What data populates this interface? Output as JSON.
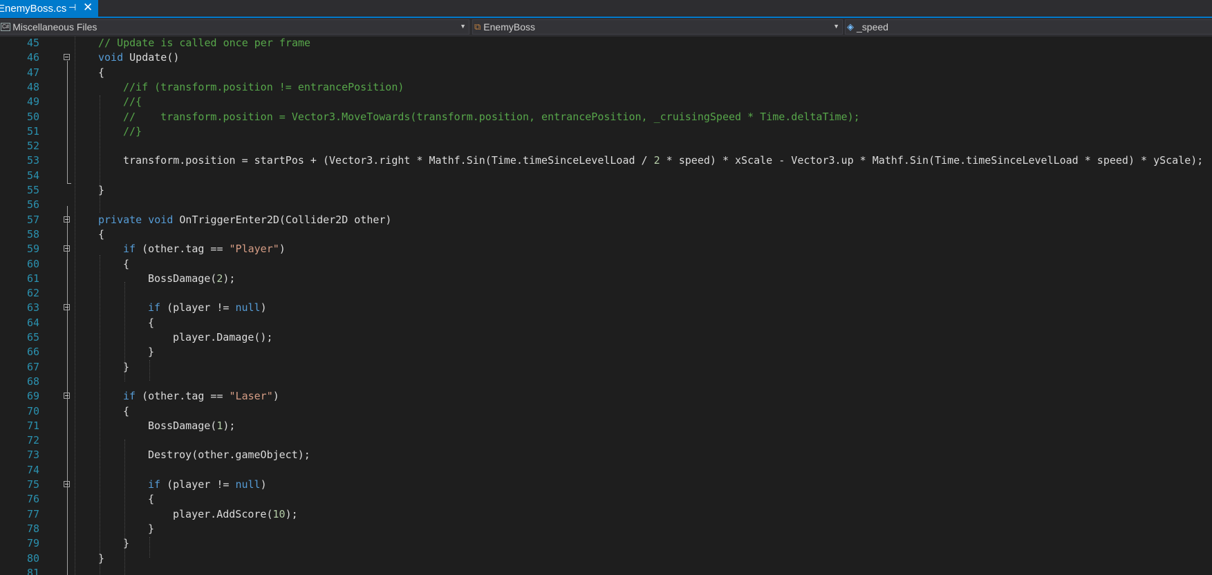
{
  "tab": {
    "title": "EnemyBoss.cs",
    "pin_icon": "pin-icon",
    "close_icon": "close-icon"
  },
  "navbar": {
    "project": {
      "badge": "C#",
      "label": "Miscellaneous Files"
    },
    "type": {
      "label": "EnemyBoss"
    },
    "member": {
      "label": "_speed"
    }
  },
  "colors": {
    "accent": "#007acc",
    "background": "#1e1e1e",
    "keyword": "#569cd6",
    "comment": "#57a64a",
    "string": "#d69d85",
    "number": "#b5cea8",
    "line_number": "#2b91af",
    "text": "#dcdcdc"
  },
  "lines": [
    {
      "n": "45",
      "fold": false,
      "indent": 0,
      "parts": [
        {
          "t": "c",
          "v": "// Update is called once per frame"
        }
      ]
    },
    {
      "n": "46",
      "fold": true,
      "indent": 0,
      "parts": [
        {
          "t": "k",
          "v": "void"
        },
        {
          "t": "p",
          "v": " Update()"
        }
      ]
    },
    {
      "n": "47",
      "fold": false,
      "indent": 0,
      "parts": [
        {
          "t": "p",
          "v": "{"
        }
      ]
    },
    {
      "n": "48",
      "fold": false,
      "indent": 1,
      "parts": [
        {
          "t": "c",
          "v": "//if (transform.position != entrancePosition)"
        }
      ]
    },
    {
      "n": "49",
      "fold": false,
      "indent": 1,
      "parts": [
        {
          "t": "c",
          "v": "//{"
        }
      ]
    },
    {
      "n": "50",
      "fold": false,
      "indent": 1,
      "parts": [
        {
          "t": "c",
          "v": "//    transform.position = Vector3.MoveTowards(transform.position, entrancePosition, _cruisingSpeed * Time.deltaTime);"
        }
      ]
    },
    {
      "n": "51",
      "fold": false,
      "indent": 1,
      "parts": [
        {
          "t": "c",
          "v": "//}"
        }
      ]
    },
    {
      "n": "52",
      "fold": false,
      "indent": 0,
      "parts": []
    },
    {
      "n": "53",
      "fold": false,
      "indent": 1,
      "parts": [
        {
          "t": "p",
          "v": "transform.position = startPos + (Vector3.right * Mathf.Sin(Time.timeSinceLevelLoad / "
        },
        {
          "t": "n",
          "v": "2"
        },
        {
          "t": "p",
          "v": " * speed) * xScale - Vector3.up * Mathf.Sin(Time.timeSinceLevelLoad * speed) * yScale);"
        }
      ]
    },
    {
      "n": "54",
      "fold": false,
      "indent": 0,
      "parts": []
    },
    {
      "n": "55",
      "fold": false,
      "indent": 0,
      "parts": [
        {
          "t": "p",
          "v": "}"
        }
      ]
    },
    {
      "n": "56",
      "fold": false,
      "indent": 0,
      "parts": []
    },
    {
      "n": "57",
      "fold": true,
      "indent": 0,
      "parts": [
        {
          "t": "k",
          "v": "private"
        },
        {
          "t": "p",
          "v": " "
        },
        {
          "t": "k",
          "v": "void"
        },
        {
          "t": "p",
          "v": " OnTriggerEnter2D(Collider2D other)"
        }
      ]
    },
    {
      "n": "58",
      "fold": false,
      "indent": 0,
      "parts": [
        {
          "t": "p",
          "v": "{"
        }
      ]
    },
    {
      "n": "59",
      "fold": true,
      "indent": 1,
      "parts": [
        {
          "t": "k",
          "v": "if"
        },
        {
          "t": "p",
          "v": " (other.tag == "
        },
        {
          "t": "s",
          "v": "\"Player\""
        },
        {
          "t": "p",
          "v": ")"
        }
      ]
    },
    {
      "n": "60",
      "fold": false,
      "indent": 1,
      "parts": [
        {
          "t": "p",
          "v": "{"
        }
      ]
    },
    {
      "n": "61",
      "fold": false,
      "indent": 2,
      "parts": [
        {
          "t": "p",
          "v": "BossDamage("
        },
        {
          "t": "n",
          "v": "2"
        },
        {
          "t": "p",
          "v": ");"
        }
      ]
    },
    {
      "n": "62",
      "fold": false,
      "indent": 0,
      "parts": []
    },
    {
      "n": "63",
      "fold": true,
      "indent": 2,
      "parts": [
        {
          "t": "k",
          "v": "if"
        },
        {
          "t": "p",
          "v": " (player != "
        },
        {
          "t": "k",
          "v": "null"
        },
        {
          "t": "p",
          "v": ")"
        }
      ]
    },
    {
      "n": "64",
      "fold": false,
      "indent": 2,
      "parts": [
        {
          "t": "p",
          "v": "{"
        }
      ]
    },
    {
      "n": "65",
      "fold": false,
      "indent": 3,
      "parts": [
        {
          "t": "p",
          "v": "player.Damage();"
        }
      ]
    },
    {
      "n": "66",
      "fold": false,
      "indent": 2,
      "parts": [
        {
          "t": "p",
          "v": "}"
        }
      ]
    },
    {
      "n": "67",
      "fold": false,
      "indent": 1,
      "parts": [
        {
          "t": "p",
          "v": "}"
        }
      ]
    },
    {
      "n": "68",
      "fold": false,
      "indent": 0,
      "parts": []
    },
    {
      "n": "69",
      "fold": true,
      "indent": 1,
      "parts": [
        {
          "t": "k",
          "v": "if"
        },
        {
          "t": "p",
          "v": " (other.tag == "
        },
        {
          "t": "s",
          "v": "\"Laser\""
        },
        {
          "t": "p",
          "v": ")"
        }
      ]
    },
    {
      "n": "70",
      "fold": false,
      "indent": 1,
      "parts": [
        {
          "t": "p",
          "v": "{"
        }
      ]
    },
    {
      "n": "71",
      "fold": false,
      "indent": 2,
      "parts": [
        {
          "t": "p",
          "v": "BossDamage("
        },
        {
          "t": "n",
          "v": "1"
        },
        {
          "t": "p",
          "v": ");"
        }
      ]
    },
    {
      "n": "72",
      "fold": false,
      "indent": 0,
      "parts": []
    },
    {
      "n": "73",
      "fold": false,
      "indent": 2,
      "parts": [
        {
          "t": "p",
          "v": "Destroy(other.gameObject);"
        }
      ]
    },
    {
      "n": "74",
      "fold": false,
      "indent": 0,
      "parts": []
    },
    {
      "n": "75",
      "fold": true,
      "indent": 2,
      "parts": [
        {
          "t": "k",
          "v": "if"
        },
        {
          "t": "p",
          "v": " (player != "
        },
        {
          "t": "k",
          "v": "null"
        },
        {
          "t": "p",
          "v": ")"
        }
      ]
    },
    {
      "n": "76",
      "fold": false,
      "indent": 2,
      "parts": [
        {
          "t": "p",
          "v": "{"
        }
      ]
    },
    {
      "n": "77",
      "fold": false,
      "indent": 3,
      "parts": [
        {
          "t": "p",
          "v": "player.AddScore("
        },
        {
          "t": "n",
          "v": "10"
        },
        {
          "t": "p",
          "v": ");"
        }
      ]
    },
    {
      "n": "78",
      "fold": false,
      "indent": 2,
      "parts": [
        {
          "t": "p",
          "v": "}"
        }
      ]
    },
    {
      "n": "79",
      "fold": false,
      "indent": 1,
      "parts": [
        {
          "t": "p",
          "v": "}"
        }
      ]
    },
    {
      "n": "80",
      "fold": false,
      "indent": 0,
      "parts": [
        {
          "t": "p",
          "v": "}"
        }
      ]
    },
    {
      "n": "81",
      "fold": false,
      "indent": 0,
      "parts": []
    }
  ]
}
